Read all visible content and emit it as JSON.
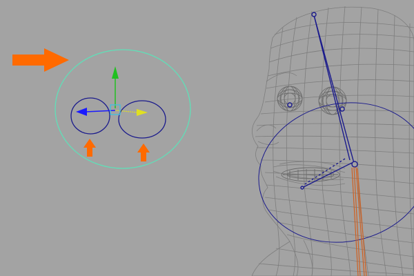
{
  "viewport": {
    "background": "#a3a3a3",
    "colors": {
      "annotation": "#ff6a00",
      "outer_control": "#5fe0b8",
      "eye_control": "#1a1a8c",
      "wireframe": "#7a7a7a",
      "bone": "#1a1a8c",
      "neck_joint": "#d06020",
      "axis_x": "#1a1aff",
      "axis_y": "#20c020",
      "axis_z": "#e0e020",
      "pivot": "#40c0e0"
    },
    "icons": {
      "big_arrow": "arrow-right-icon",
      "small_arrow": "arrow-up-icon",
      "manipulator": "move-manipulator-icon"
    }
  }
}
